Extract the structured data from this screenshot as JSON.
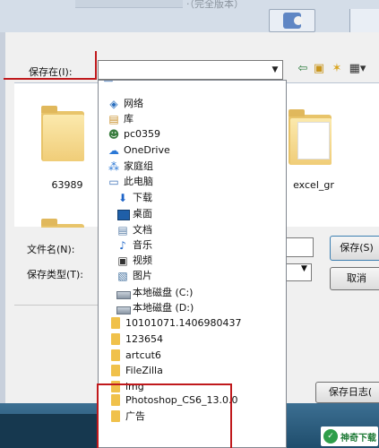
{
  "top_bar": {
    "title_fragment": "·（完全版本）"
  },
  "toolbar": {
    "save_in_label": "保存在(I):",
    "save_in_value": "",
    "back_icon": "back-arrow-icon",
    "up_icon": "folder-up-icon",
    "new_folder_icon": "new-folder-icon",
    "view_menu_icon": "view-menu-icon"
  },
  "browser": {
    "folders": [
      {
        "label": "63989"
      },
      {
        "label": "excel_gr"
      }
    ]
  },
  "form": {
    "file_name_label": "文件名(N):",
    "file_type_label": "保存类型(T):",
    "save_button": "保存(S)",
    "cancel_button": "取消"
  },
  "bottom": {
    "save_log_button": "保存日志(",
    "logo_text": "神奇下载"
  },
  "dropdown": {
    "items": [
      {
        "label": "网络",
        "icon": "network-icon"
      },
      {
        "label": "库",
        "icon": "library-icon"
      },
      {
        "label": "pc0359",
        "icon": "user-icon"
      },
      {
        "label": "OneDrive",
        "icon": "cloud-icon"
      },
      {
        "label": "家庭组",
        "icon": "homegroup-icon"
      },
      {
        "label": "此电脑",
        "icon": "computer-icon"
      },
      {
        "label": "下载",
        "icon": "download-icon"
      },
      {
        "label": "桌面",
        "icon": "desktop-icon"
      },
      {
        "label": "文档",
        "icon": "document-icon"
      },
      {
        "label": "音乐",
        "icon": "music-icon"
      },
      {
        "label": "视频",
        "icon": "video-icon"
      },
      {
        "label": "图片",
        "icon": "picture-icon"
      },
      {
        "label": "本地磁盘 (C:)",
        "icon": "disk-icon"
      },
      {
        "label": "本地磁盘 (D:)",
        "icon": "disk-icon"
      },
      {
        "label": "10101071.1406980437",
        "icon": "folder-icon"
      },
      {
        "label": "123654",
        "icon": "folder-icon"
      },
      {
        "label": "artcut6",
        "icon": "folder-icon"
      },
      {
        "label": "FileZilla",
        "icon": "folder-icon"
      },
      {
        "label": "img",
        "icon": "folder-icon"
      },
      {
        "label": "Photoshop_CS6_13.0.0",
        "icon": "folder-icon"
      },
      {
        "label": "广告",
        "icon": "folder-icon"
      }
    ]
  },
  "colors": {
    "highlight_red": "#c0191c",
    "folder_yellow": "#f0c14b",
    "desktop_blue": "#2a5a78"
  }
}
